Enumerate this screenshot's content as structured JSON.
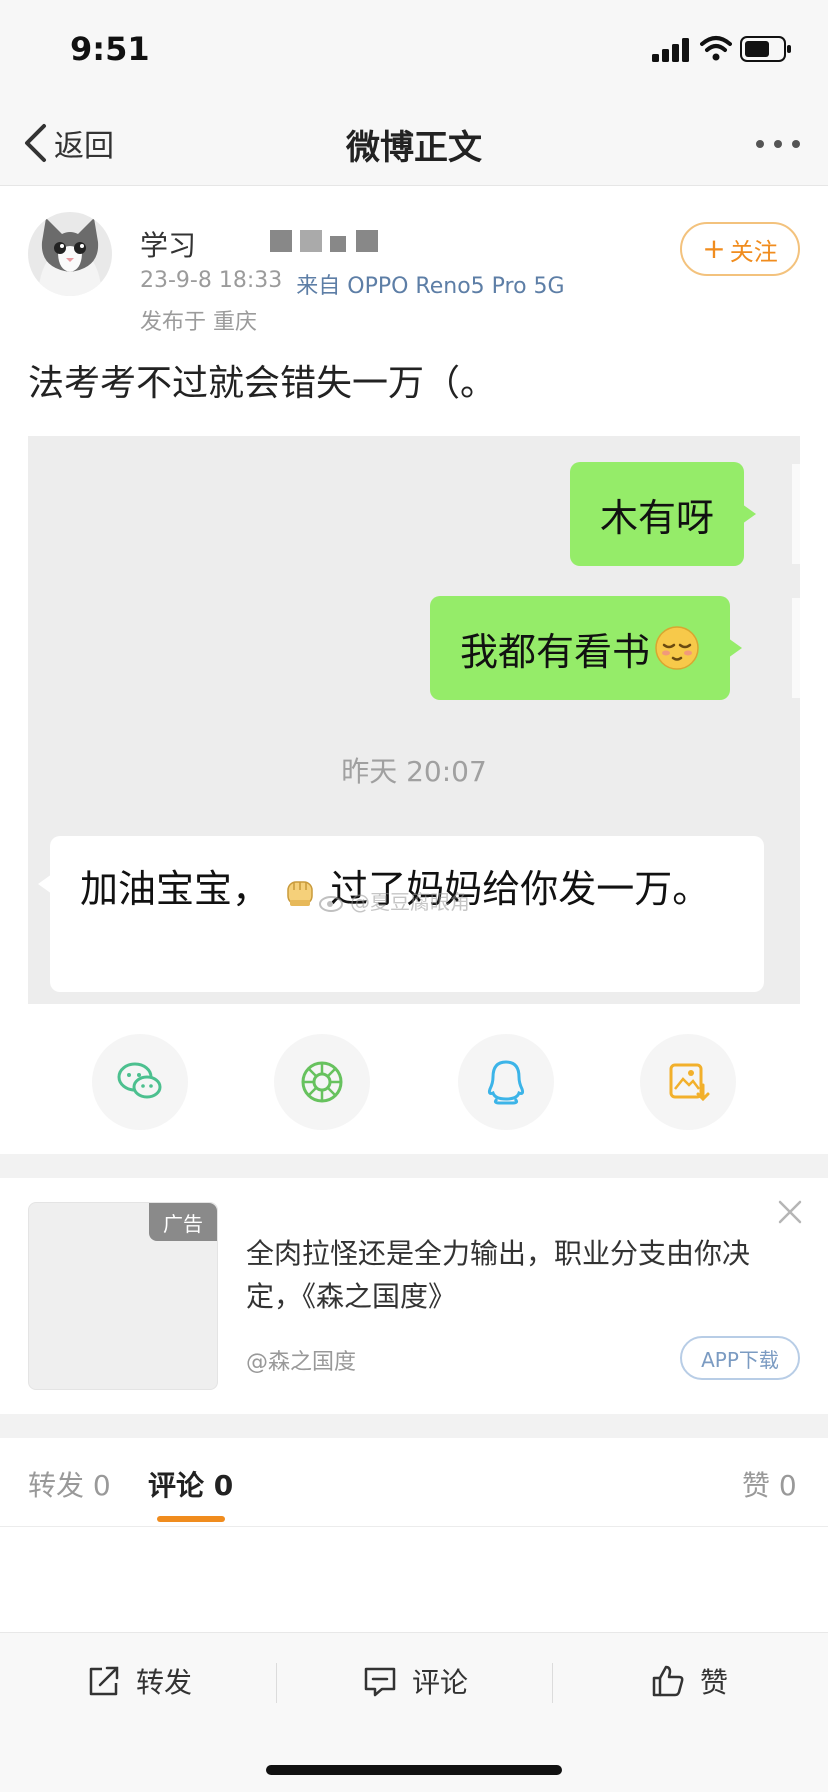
{
  "status_bar": {
    "time": "9:51"
  },
  "nav": {
    "back_label": "返回",
    "title": "微博正文"
  },
  "post": {
    "author_name": "学习",
    "date": "23-9-8 18:33",
    "source": "来自 OPPO Reno5 Pro 5G",
    "location": "发布于 重庆",
    "follow_label": "关注",
    "text": "法考考不过就会错失一万（。"
  },
  "chat": {
    "message_1": "木有呀",
    "message_2": "我都有看书",
    "time": "昨天 20:07",
    "reply_part_1": "加油宝宝，",
    "reply_part_2": "过了妈妈给你发一万。",
    "watermark": "@夏豆腐眼角"
  },
  "share": [
    "wechat-icon",
    "moments-icon",
    "qq-icon",
    "save-image-icon"
  ],
  "ad": {
    "badge": "广告",
    "title": "全肉拉怪还是全力输出，职业分支由你决定，《森之国度》",
    "author": "@森之国度",
    "download_label": "APP下载"
  },
  "tabs": {
    "repost": "转发 0",
    "comment": "评论 0",
    "like": "赞 0"
  },
  "bottom_bar": {
    "repost_label": "转发",
    "comment_label": "评论",
    "like_label": "赞"
  },
  "colors": {
    "accent": "#f08c1e",
    "chat_green": "#95ec69",
    "source_blue": "#5d7ea6"
  }
}
